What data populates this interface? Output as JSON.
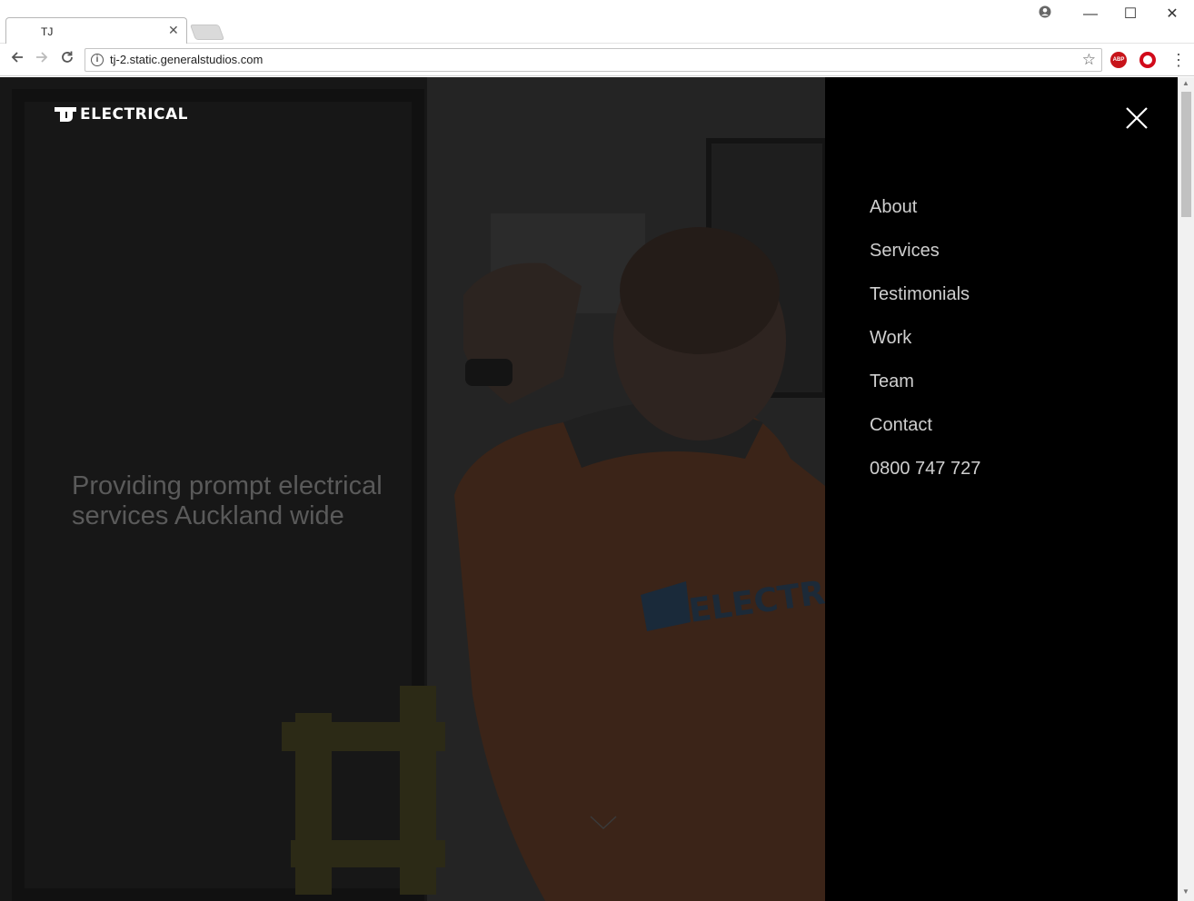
{
  "browser": {
    "tab_title": "TJ",
    "tab_close": "✕",
    "url": "tj-2.static.generalstudios.com",
    "minimize": "—",
    "maximize": "☐",
    "close": "✕",
    "ext_abp": "ABP"
  },
  "site": {
    "logo_mark": "TJ",
    "logo_text": "ELECTRICAL",
    "tagline": "Providing prompt electrical services Auckland wide",
    "accent": "#e86b1f"
  },
  "menu": {
    "items": [
      "About",
      "Services",
      "Testimonials",
      "Work",
      "Team",
      "Contact",
      "0800 747 727"
    ]
  }
}
